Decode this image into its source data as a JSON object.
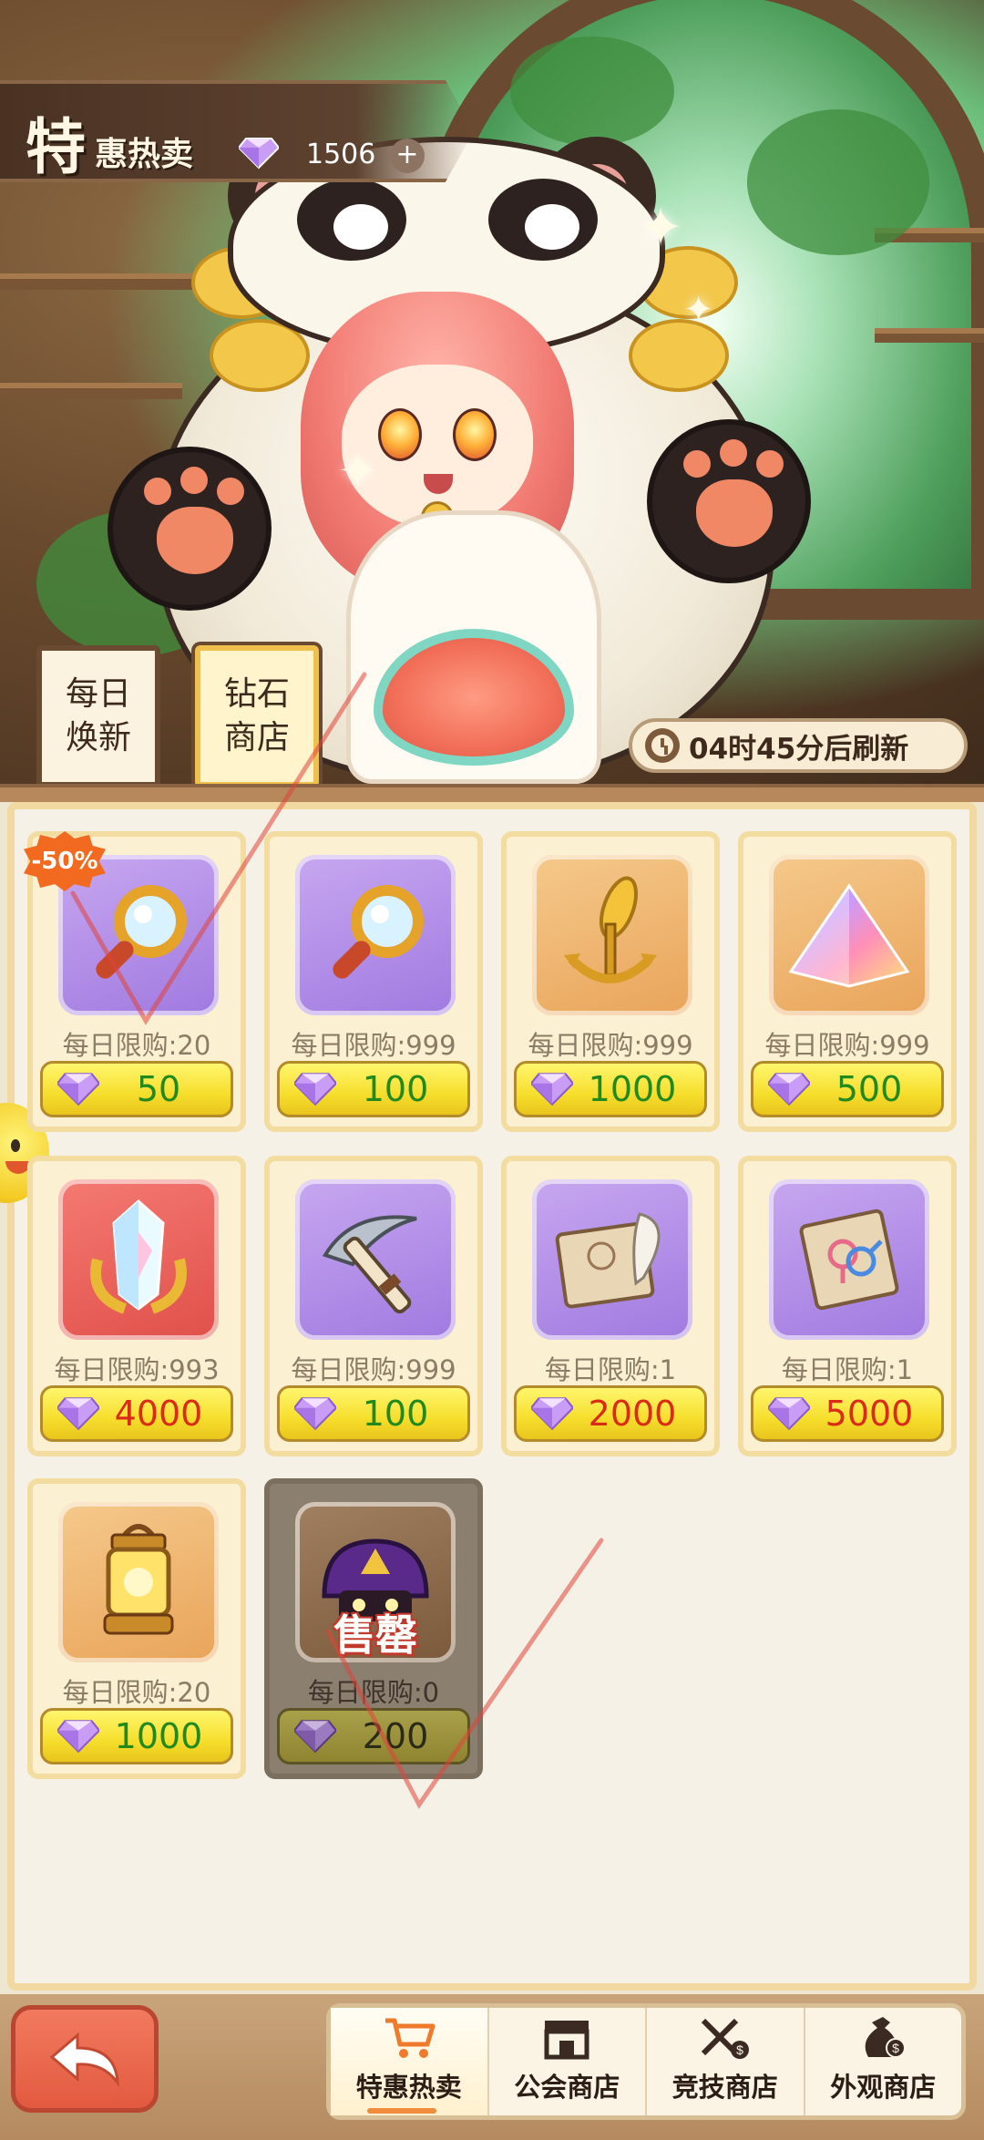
{
  "header": {
    "title_char": "特",
    "title_rest": "惠热卖",
    "currency_icon": "diamond-icon",
    "currency_amount": "1506",
    "add_label": "+"
  },
  "side_tabs": [
    {
      "label": "每日\n焕新",
      "active": false
    },
    {
      "label": "钻石\n商店",
      "active": true
    }
  ],
  "refresh": {
    "icon": "alarm-clock-icon",
    "text": "04时45分后刷新"
  },
  "items": [
    {
      "icon": "magnifier-icon",
      "bg": "purple",
      "limit": "每日限购:20",
      "price": "50",
      "price_color": "green",
      "discount": "-50%",
      "sold_out": false
    },
    {
      "icon": "magnifier-icon",
      "bg": "purple",
      "limit": "每日限购:999",
      "price": "100",
      "price_color": "green",
      "sold_out": false
    },
    {
      "icon": "golden-anchor-icon",
      "bg": "orange",
      "limit": "每日限购:999",
      "price": "1000",
      "price_color": "green",
      "sold_out": false
    },
    {
      "icon": "rainbow-pyramid-icon",
      "bg": "orange",
      "limit": "每日限购:999",
      "price": "500",
      "price_color": "green",
      "sold_out": false
    },
    {
      "icon": "crystal-crest-icon",
      "bg": "red",
      "limit": "每日限购:993",
      "price": "4000",
      "price_color": "red",
      "sold_out": false
    },
    {
      "icon": "pickaxe-icon",
      "bg": "purple",
      "limit": "每日限购:999",
      "price": "100",
      "price_color": "green",
      "sold_out": false
    },
    {
      "icon": "scroll-quill-icon",
      "bg": "purple",
      "limit": "每日限购:1",
      "price": "2000",
      "price_color": "red",
      "sold_out": false
    },
    {
      "icon": "gender-scroll-icon",
      "bg": "purple",
      "limit": "每日限购:1",
      "price": "5000",
      "price_color": "red",
      "sold_out": false
    },
    {
      "icon": "lantern-icon",
      "bg": "orange",
      "limit": "每日限购:20",
      "price": "1000",
      "price_color": "green",
      "sold_out": false
    },
    {
      "icon": "purple-helmet-icon",
      "bg": "dark",
      "limit": "每日限购:0",
      "price": "200",
      "price_color": "green",
      "sold_out": true,
      "sold_out_label": "售罄"
    }
  ],
  "nav": [
    {
      "label": "特惠热卖",
      "icon": "shopping-cart-icon",
      "active": true
    },
    {
      "label": "公会商店",
      "icon": "storefront-icon",
      "active": false
    },
    {
      "label": "竞技商店",
      "icon": "crossed-swords-icon",
      "active": false
    },
    {
      "label": "外观商店",
      "icon": "money-bag-icon",
      "active": false
    }
  ],
  "back_button": {
    "icon": "back-arrow-icon"
  },
  "colors": {
    "price_green": "#208a1f",
    "price_red": "#d92b17",
    "discount_orange": "#f26a1f",
    "nav_active": "#ef8d3c"
  }
}
